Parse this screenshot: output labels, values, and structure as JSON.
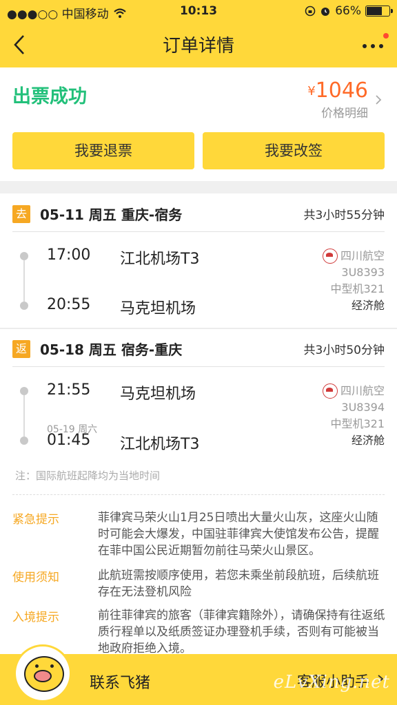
{
  "status_bar": {
    "carrier": "●●●○○ 中国移动",
    "time": "10:13",
    "battery": "66%"
  },
  "nav": {
    "title": "订单详情"
  },
  "summary": {
    "status": "出票成功",
    "price_symbol": "¥",
    "price": "1046",
    "price_detail": "价格明细",
    "refund_button": "我要退票",
    "change_button": "我要改签"
  },
  "legs": [
    {
      "tag": "去",
      "title": "05-11 周五 重庆-宿务",
      "duration": "共3小时55分钟",
      "dep_time": "17:00",
      "dep_airport": "江北机场T3",
      "arr_date": "",
      "arr_time": "20:55",
      "arr_airport": "马克坦机场",
      "airline": "四川航空",
      "flight": "3U8393",
      "aircraft": "中型机321",
      "cabin": "经济舱"
    },
    {
      "tag": "返",
      "title": "05-18 周五 宿务-重庆",
      "duration": "共3小时50分钟",
      "dep_time": "21:55",
      "dep_airport": "马克坦机场",
      "arr_date": "05-19 周六",
      "arr_time": "01:45",
      "arr_airport": "江北机场T3",
      "airline": "四川航空",
      "flight": "3U8394",
      "aircraft": "中型机321",
      "cabin": "经济舱"
    }
  ],
  "note": "注：国际航班起降均为当地时间",
  "tips": [
    {
      "label": "紧急提示",
      "text": "菲律宾马荣火山1月25日喷出大量火山灰，这座火山随时可能会大爆发，中国驻菲律宾大使馆发布公告，提醒在菲中国公民近期暂勿前往马荣火山景区。"
    },
    {
      "label": "使用须知",
      "text": "此航班需按顺序使用，若您未乘坐前段航班，后续航班存在无法登机风险"
    },
    {
      "label": "入境提示",
      "text": "前往菲律宾的旅客（菲律宾籍除外），请确保持有往返纸质行程单以及纸质签证办理登机手续，否则有可能被当地政府拒绝入境。"
    }
  ],
  "footer": {
    "contact": "联系飞猪",
    "assistant": "客服小助手",
    "watermark": "eLvXing.net"
  },
  "colors": {
    "brand_yellow": "#ffd83a",
    "success_green": "#22c07a",
    "price_orange": "#ff6a28",
    "tag_orange": "#f6a823"
  }
}
